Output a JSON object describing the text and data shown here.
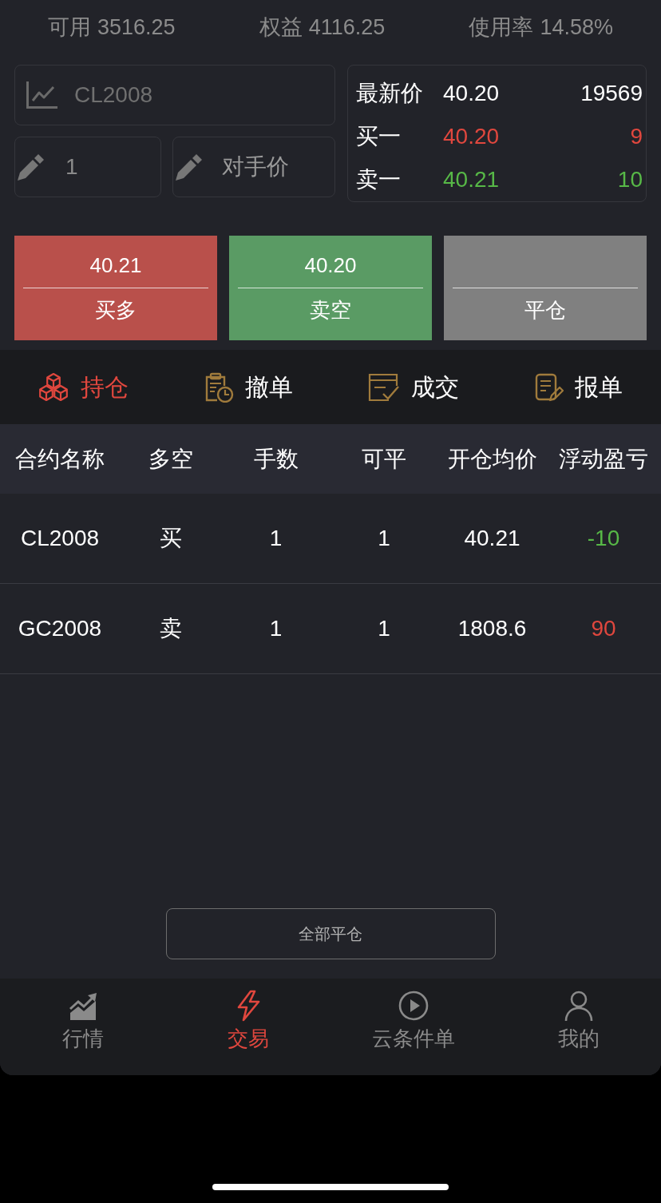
{
  "summary": [
    {
      "label": "可用",
      "value": "3516.25"
    },
    {
      "label": "权益",
      "value": "4116.25"
    },
    {
      "label": "使用率",
      "value": "14.58%"
    }
  ],
  "order_form": {
    "symbol": {
      "value": "CL2008"
    },
    "quantity": {
      "value": "1"
    },
    "price_type": {
      "value": "对手价"
    }
  },
  "quote": [
    {
      "label": "最新价",
      "price": "40.20",
      "volume": "19569",
      "color": "#ffffff"
    },
    {
      "label": "买一",
      "price": "40.20",
      "volume": "9",
      "color": "#e0473e"
    },
    {
      "label": "卖一",
      "price": "40.21",
      "volume": "10",
      "color": "#57b847"
    }
  ],
  "actions": [
    {
      "price": "40.21",
      "label": "买多",
      "color": "#b9504b"
    },
    {
      "price": "40.20",
      "label": "卖空",
      "color": "#5a9b64"
    },
    {
      "label": "平仓",
      "color": "#808080"
    }
  ],
  "tabs": [
    {
      "label": "持仓",
      "selected": true
    },
    {
      "label": "撤单",
      "selected": false
    },
    {
      "label": "成交",
      "selected": false
    },
    {
      "label": "报单",
      "selected": false
    }
  ],
  "table": {
    "columns": [
      "合约名称",
      "多空",
      "手数",
      "可平",
      "开仓均价",
      "浮动盈亏"
    ],
    "rows": [
      {
        "cells": [
          "CL2008",
          "买",
          "1",
          "1",
          "40.21",
          "-10"
        ],
        "color": "#57b847"
      },
      {
        "cells": [
          "GC2008",
          "卖",
          "1",
          "1",
          "1808.6",
          "90"
        ],
        "color": "#e0473e"
      }
    ]
  },
  "close_all_button": {
    "label": "全部平仓"
  },
  "bottom_nav": [
    {
      "label": "行情",
      "selected": false
    },
    {
      "label": "交易",
      "selected": true
    },
    {
      "label": "云条件单",
      "selected": false
    },
    {
      "label": "我的",
      "selected": false
    }
  ]
}
